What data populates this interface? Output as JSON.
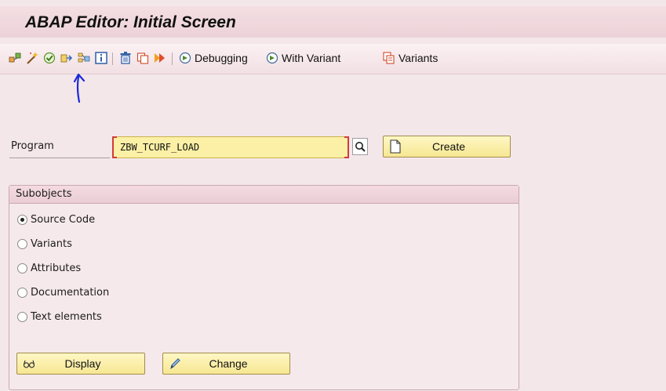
{
  "window": {
    "title": "ABAP Editor: Initial Screen"
  },
  "toolbar": {
    "icons": [
      "object-list-icon",
      "magic-wand-icon",
      "check-icon",
      "other-object-icon",
      "where-used-icon",
      "info-icon",
      "delete-icon",
      "copy-icon",
      "rename-icon"
    ],
    "debugging_label": "Debugging",
    "with_variant_label": "With Variant",
    "variants_label": "Variants"
  },
  "program": {
    "label": "Program",
    "value": "ZBW_TCURF_LOAD",
    "create_label": "Create"
  },
  "subobjects": {
    "title": "Subobjects",
    "options": [
      {
        "label": "Source Code",
        "selected": true
      },
      {
        "label": "Variants",
        "selected": false
      },
      {
        "label": "Attributes",
        "selected": false
      },
      {
        "label": "Documentation",
        "selected": false
      },
      {
        "label": "Text elements",
        "selected": false
      }
    ]
  },
  "actions": {
    "display_label": "Display",
    "change_label": "Change"
  },
  "colors": {
    "input_bg": "#fbf0a5",
    "annotation_arrow": "#1a2bd6",
    "required_bracket": "#d23b3b"
  }
}
